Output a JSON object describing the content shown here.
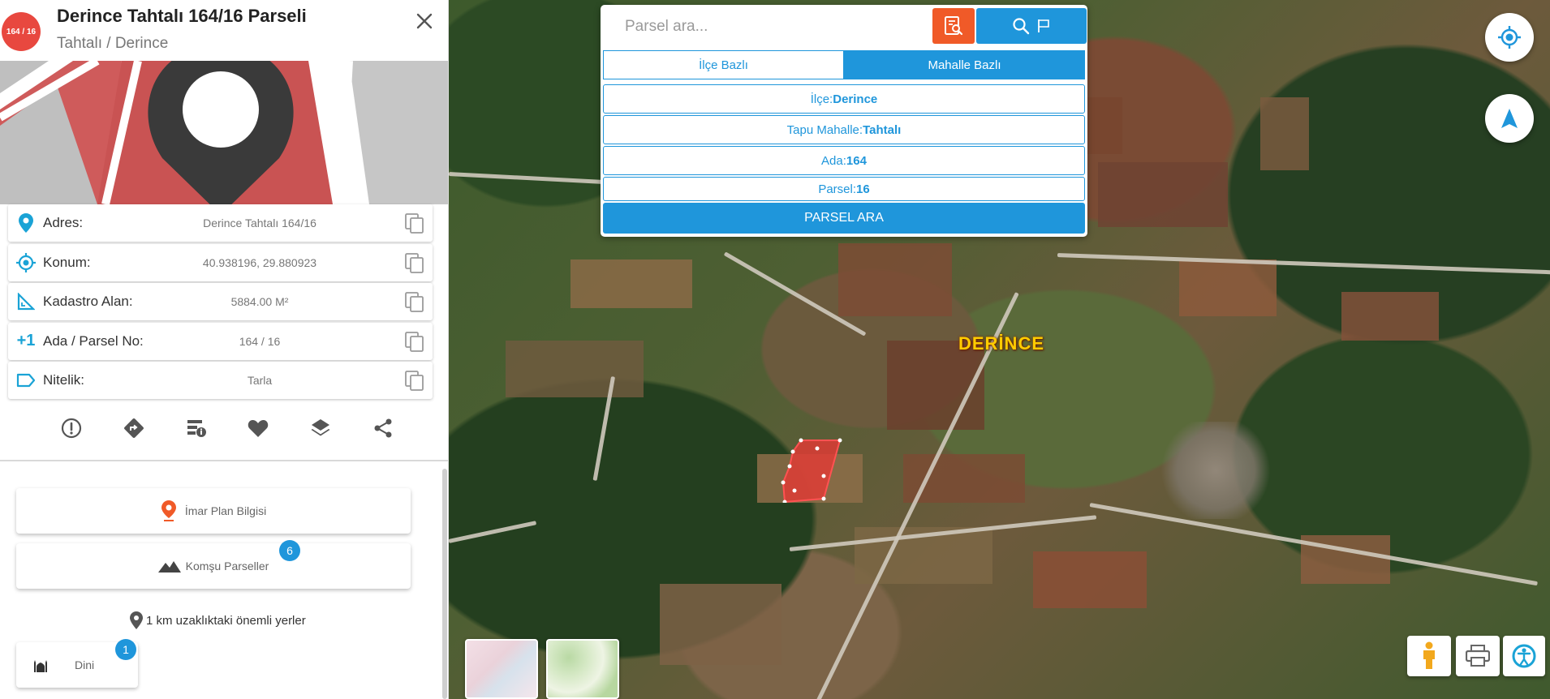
{
  "sidebar": {
    "badge": "164 / 16",
    "title": "Derince Tahtalı 164/16 Parseli",
    "subtitle": "Tahtalı / Derince",
    "info": [
      {
        "icon": "location-pin-icon",
        "label": "Adres:",
        "value": "Derince Tahtalı 164/16"
      },
      {
        "icon": "target-icon",
        "label": "Konum:",
        "value": "40.938196, 29.880923"
      },
      {
        "icon": "area-ruler-icon",
        "label": "Kadastro Alan:",
        "value": "5884.00 M²"
      },
      {
        "icon": "plus-one-icon",
        "icon_text": "+1",
        "label": "Ada / Parsel No:",
        "value": "164 / 16"
      },
      {
        "icon": "tag-icon",
        "label": "Nitelik:",
        "value": "Tarla"
      }
    ],
    "imar_label": "İmar Plan Bilgisi",
    "komsu_label": "Komşu Parseller",
    "komsu_count": "6",
    "nearby_label": "1 km uzaklıktaki önemli yerler",
    "dini_label": "Dini",
    "dini_count": "1"
  },
  "search": {
    "placeholder": "Parsel ara...",
    "tab_ilce": "İlçe Bazlı",
    "tab_mahalle": "Mahalle Bazlı",
    "ilce_label": "İlçe:",
    "ilce_value": "Derince",
    "mahalle_label": "Tapu Mahalle:",
    "mahalle_value": "Tahtalı",
    "ada_label": "Ada:",
    "ada_value": "164",
    "parsel_label": "Parsel:",
    "parsel_value": "16",
    "submit_label": "PARSEL ARA"
  },
  "map": {
    "place_label": "DERİNCE"
  },
  "colors": {
    "accent_blue": "#1f96db",
    "accent_orange": "#f05a28",
    "badge_red": "#e8483f",
    "icon_blue": "#1aa3d6",
    "parcel_red": "#e53935",
    "label_yellow": "#ffcc00"
  }
}
